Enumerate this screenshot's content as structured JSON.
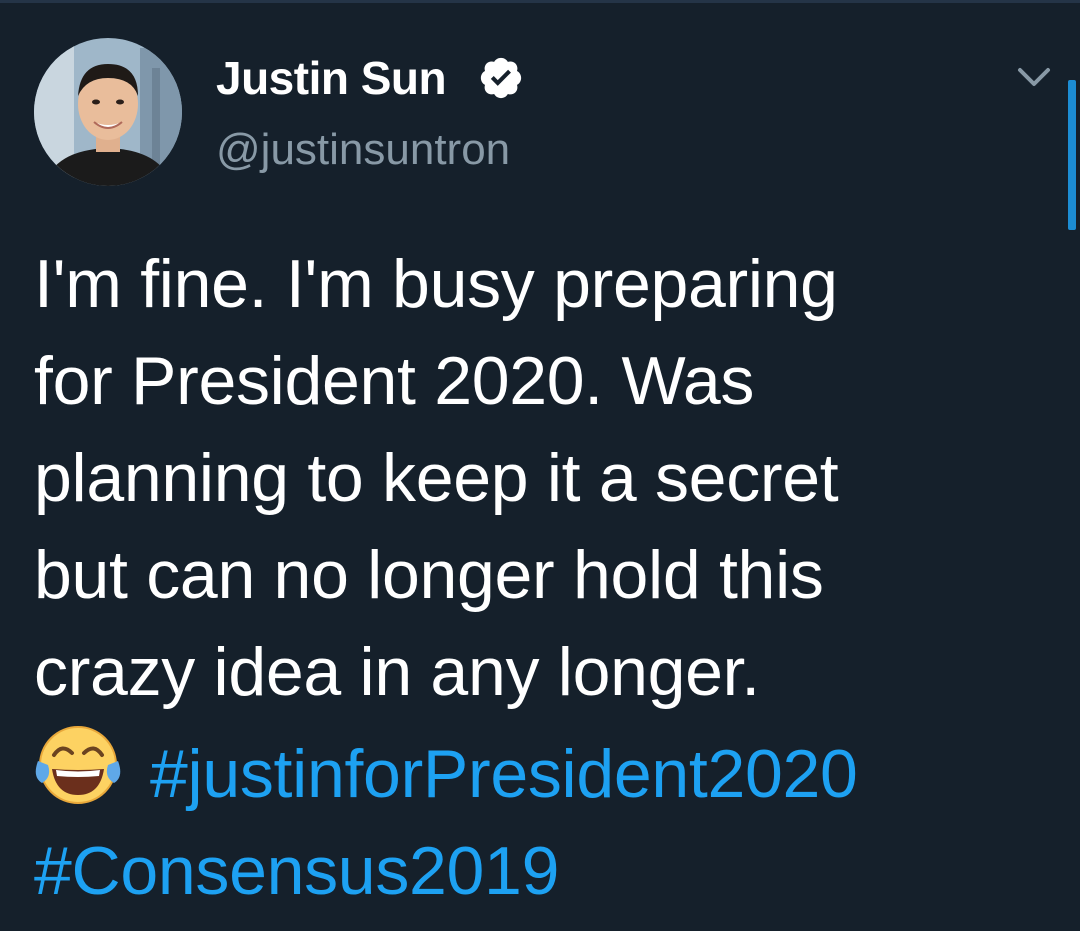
{
  "tweet": {
    "author": {
      "display_name": "Justin Sun",
      "handle": "@justinsuntron",
      "verified": true,
      "avatar_icon": "profile-photo"
    },
    "text_lines": [
      "I'm fine. I'm busy preparing",
      "for President 2020. Was",
      "planning to keep it a secret",
      "but can no longer hold this",
      "crazy idea in any longer."
    ],
    "emoji_icon": "face-with-tears-of-joy-icon",
    "hashtags": [
      "#justinforPresident2020",
      "#Consensus2019"
    ],
    "menu_icon": "chevron-down-icon"
  },
  "colors": {
    "background": "#15202b",
    "text": "#ffffff",
    "secondary_text": "#8899a6",
    "accent": "#1da1f2"
  }
}
